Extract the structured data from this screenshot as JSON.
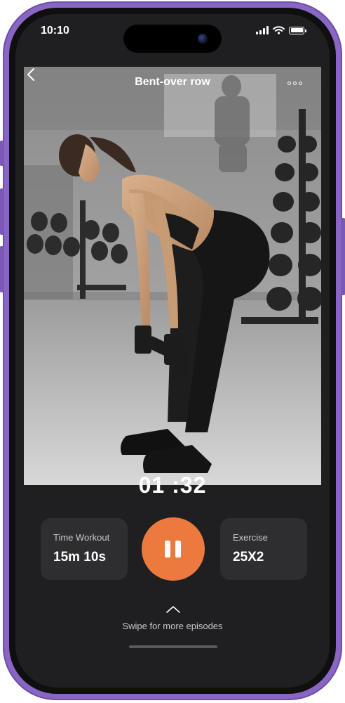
{
  "status_bar": {
    "time": "10:10"
  },
  "header": {
    "title": "Bent-over row"
  },
  "player": {
    "elapsed": "01 :32",
    "is_playing": true
  },
  "stats": {
    "time_workout": {
      "label": "Time Workout",
      "value": "15m 10s"
    },
    "exercise": {
      "label": "Exercise",
      "value": "25X2"
    }
  },
  "footer": {
    "swipe_hint": "Swipe for more episodes"
  },
  "icons": {
    "back": "chevron-left-icon",
    "more": "more-horizontal-icon",
    "pause": "pause-icon",
    "swipe": "chevron-up-icon"
  },
  "colors": {
    "accent": "#ec7a3e",
    "frame": "#8a66c4",
    "background": "#1f1f21",
    "card": "#2e2e31"
  }
}
